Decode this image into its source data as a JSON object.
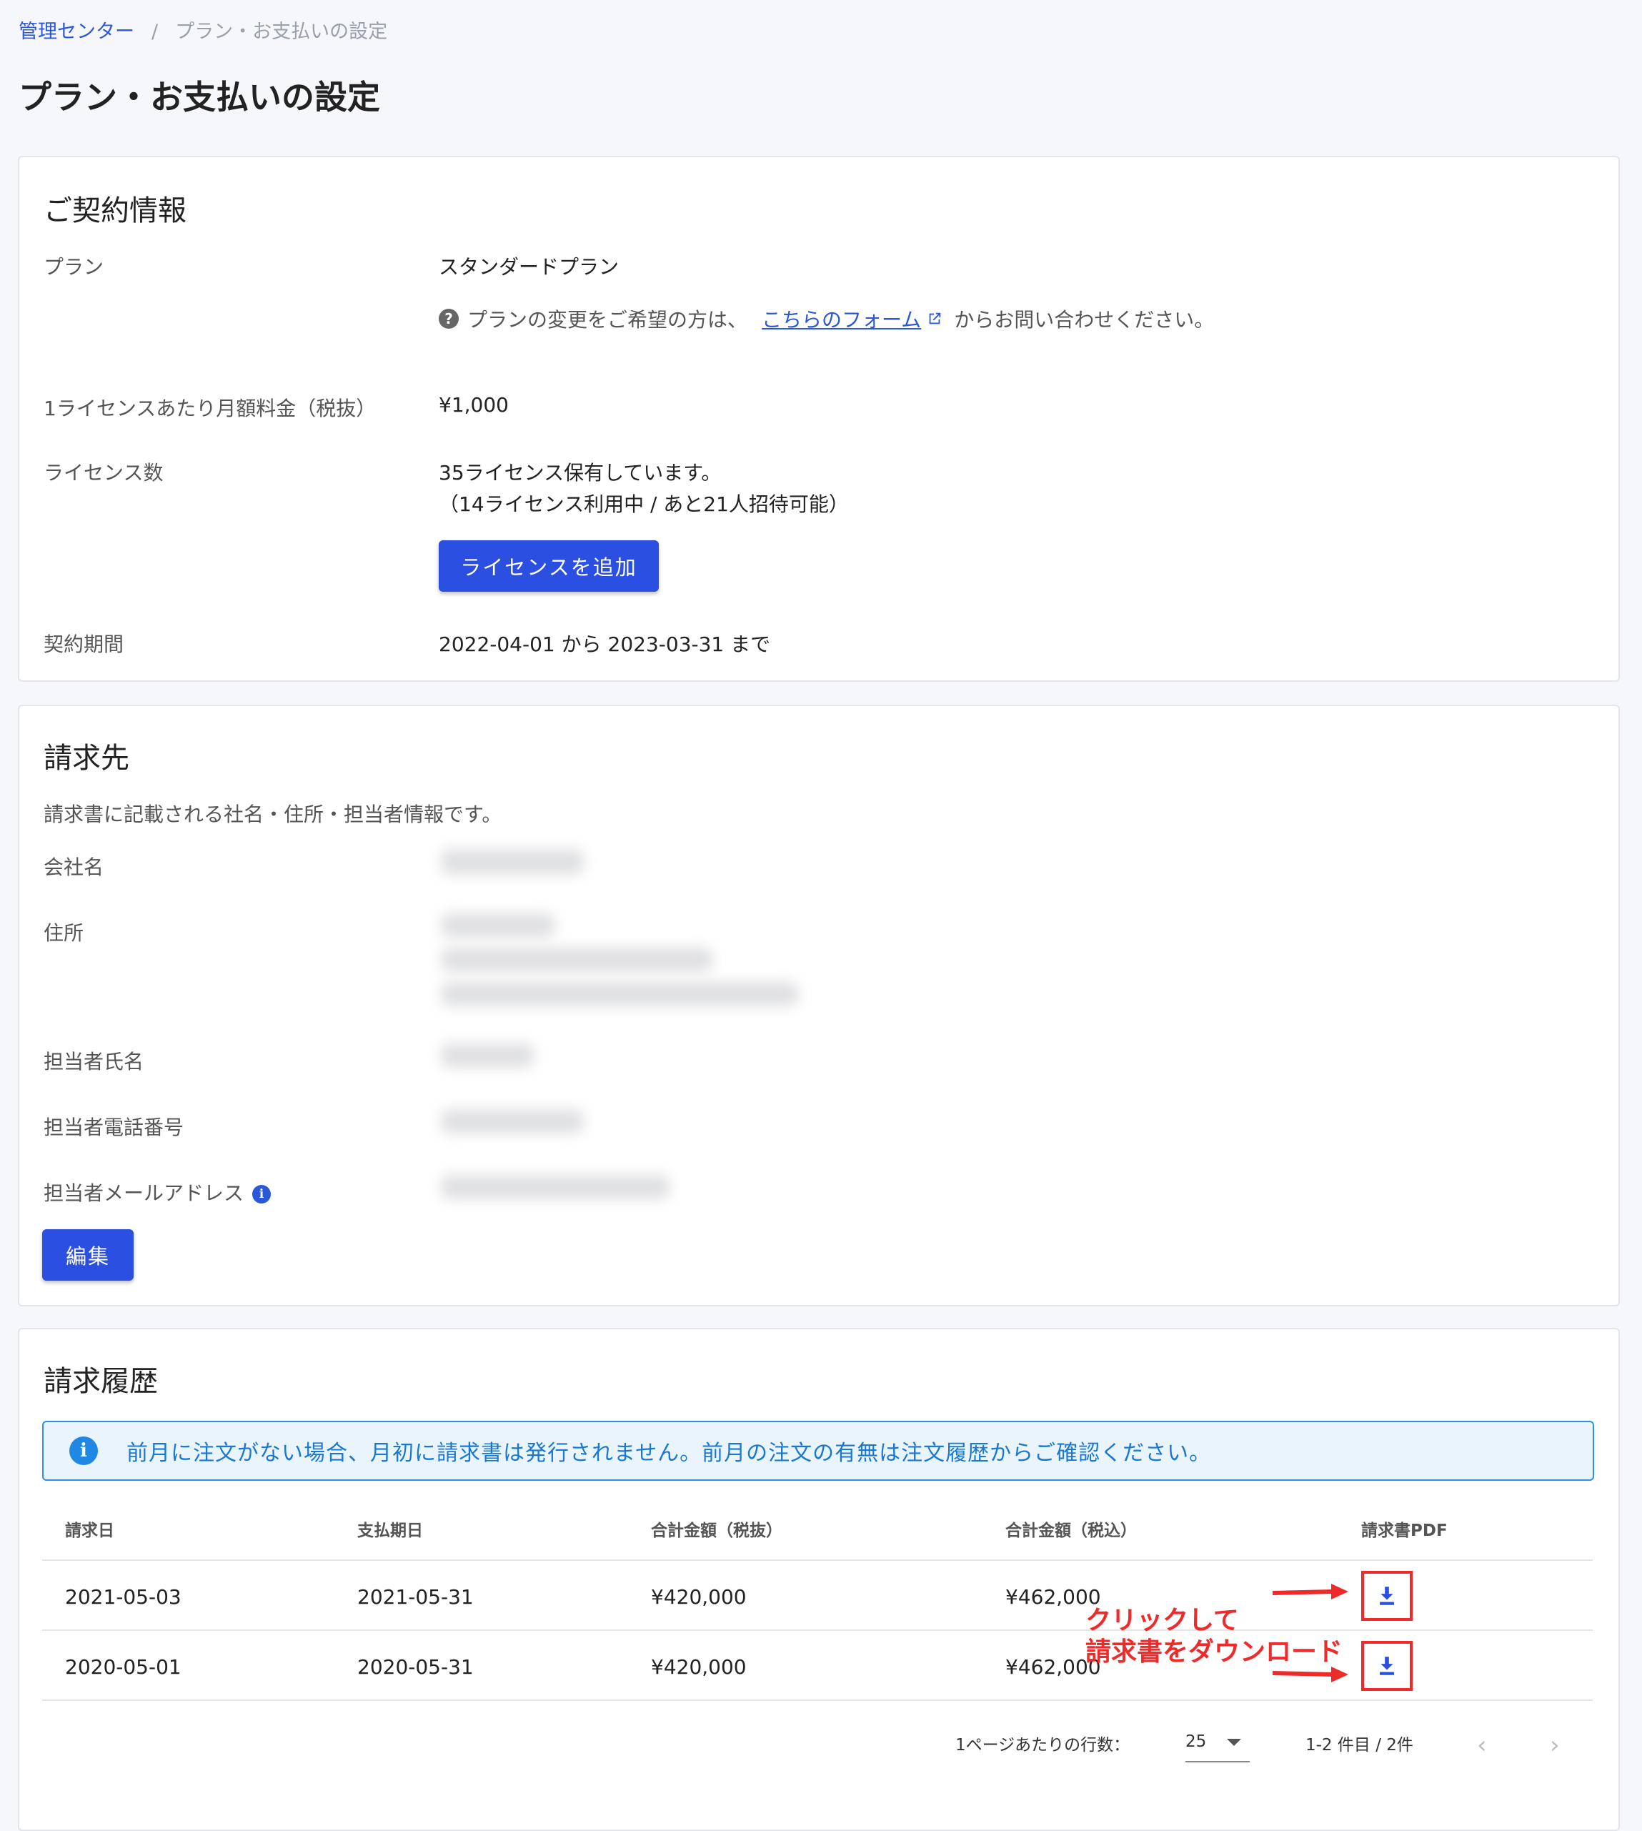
{
  "breadcrumb": {
    "parent": "管理センター",
    "separator": "/",
    "current": "プラン・お支払いの設定"
  },
  "page_title": "プラン・お支払いの設定",
  "contract": {
    "title": "ご契約情報",
    "plan_label": "プラン",
    "plan_value": "スタンダードプラン",
    "plan_note_prefix": "プランの変更をご希望の方は、",
    "plan_note_link": "こちらのフォーム",
    "plan_note_suffix": "からお問い合わせください。",
    "price_label": "1ライセンスあたり月額料金（税抜）",
    "price_value": "¥1,000",
    "licenses_label": "ライセンス数",
    "licenses_line1": "35ライセンス保有しています。",
    "licenses_line2": "（14ライセンス利用中 / あと21人招待可能）",
    "add_license_button": "ライセンスを追加",
    "period_label": "契約期間",
    "period_value": "2022-04-01 から 2023-03-31 まで"
  },
  "billing": {
    "title": "請求先",
    "description": "請求書に記載される社名・住所・担当者情報です。",
    "company_label": "会社名",
    "address_label": "住所",
    "contact_name_label": "担当者氏名",
    "contact_phone_label": "担当者電話番号",
    "contact_email_label": "担当者メールアドレス",
    "edit_button": "編集"
  },
  "history": {
    "title": "請求履歴",
    "alert": "前月に注文がない場合、月初に請求書は発行されません。前月の注文の有無は注文履歴からご確認ください。",
    "columns": [
      "請求日",
      "支払期日",
      "合計金額（税抜）",
      "合計金額（税込）",
      "請求書PDF"
    ],
    "rows": [
      [
        "2021-05-03",
        "2021-05-31",
        "¥420,000",
        "¥462,000"
      ],
      [
        "2020-05-01",
        "2020-05-31",
        "¥420,000",
        "¥462,000"
      ]
    ],
    "annotation_line1": "クリックして",
    "annotation_line2": "請求書をダウンロード",
    "rows_per_page_label": "1ページあたりの行数：",
    "rows_per_page_value": "25",
    "range_text": "1-2 件目 / 2件"
  },
  "colors": {
    "primary": "#2b4fe0",
    "link": "#2b57d9",
    "annotation": "#ee2a2a",
    "alert_border": "#2f8fe0",
    "alert_bg": "#e9f4fd"
  }
}
